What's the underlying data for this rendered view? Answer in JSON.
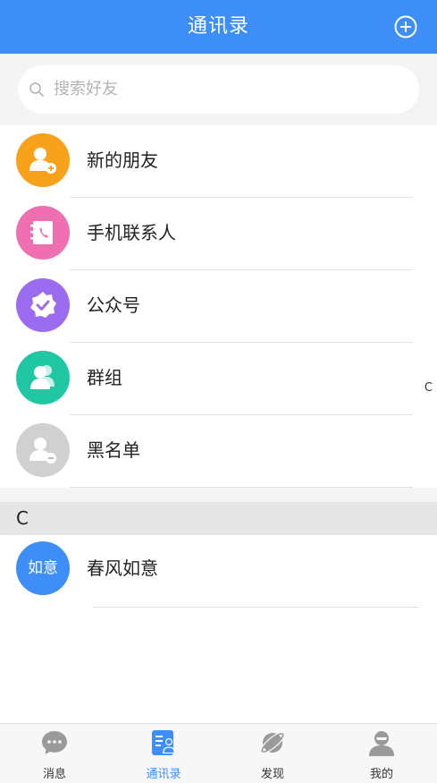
{
  "header": {
    "title": "通讯录",
    "add_icon": "plus-circle-icon"
  },
  "search": {
    "placeholder": "搜索好友",
    "icon": "search-icon"
  },
  "menu": [
    {
      "label": "新的朋友",
      "icon": "add-friend-icon",
      "color": "#f8a21c"
    },
    {
      "label": "手机联系人",
      "icon": "phone-book-icon",
      "color": "#f06fb0"
    },
    {
      "label": "公众号",
      "icon": "verified-badge-icon",
      "color": "#9b6cf0"
    },
    {
      "label": "群组",
      "icon": "group-icon",
      "color": "#1fc8a3"
    },
    {
      "label": "黑名单",
      "icon": "blocked-user-icon",
      "color": "#d0d0d0"
    }
  ],
  "index": {
    "letter": "C"
  },
  "section": {
    "letter": "C"
  },
  "contacts": [
    {
      "avatar_text": "如意",
      "name": "春风如意",
      "avatar_color": "#3e8ef7"
    }
  ],
  "tabs": [
    {
      "label": "消息",
      "icon": "chat-bubble-icon",
      "active": false
    },
    {
      "label": "通讯录",
      "icon": "contacts-book-icon",
      "active": true
    },
    {
      "label": "发现",
      "icon": "planet-icon",
      "active": false
    },
    {
      "label": "我的",
      "icon": "user-profile-icon",
      "active": false
    }
  ],
  "colors": {
    "brand": "#3e8ef7",
    "tab_inactive": "#9a9a9a"
  }
}
